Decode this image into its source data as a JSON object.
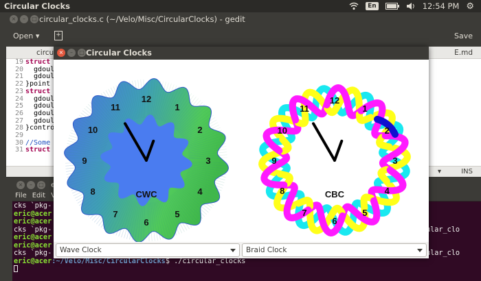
{
  "top_panel": {
    "app_title": "Circular Clocks",
    "keyboard_layout": "En",
    "clock": "12:54 PM",
    "icons": [
      "wifi-icon",
      "keyboard-icon",
      "battery-icon",
      "volume-icon",
      "power-gear-icon"
    ]
  },
  "gedit": {
    "title": "circular_clocks.c (~/Velo/Misc/CircularClocks) - gedit",
    "open_label": "Open",
    "save_label": "Save",
    "tab_left": "circul",
    "tab_right": "E.md",
    "status_ins": "INS",
    "code_lines": [
      {
        "n": "19",
        "text": "struct",
        "cls": "kw"
      },
      {
        "n": "20",
        "text": "  gdoul",
        "cls": ""
      },
      {
        "n": "21",
        "text": "  gdoul",
        "cls": ""
      },
      {
        "n": "22",
        "text": "}point",
        "cls": ""
      },
      {
        "n": "23",
        "text": "struct",
        "cls": "kw"
      },
      {
        "n": "24",
        "text": "  gdoul",
        "cls": ""
      },
      {
        "n": "25",
        "text": "  gdoul",
        "cls": ""
      },
      {
        "n": "26",
        "text": "  gdoul",
        "cls": ""
      },
      {
        "n": "27",
        "text": "  gdoul",
        "cls": ""
      },
      {
        "n": "28",
        "text": "}contro",
        "cls": ""
      },
      {
        "n": "29",
        "text": "",
        "cls": ""
      },
      {
        "n": "30",
        "text": "//Some",
        "cls": "cm"
      },
      {
        "n": "31",
        "text": "struct",
        "cls": "kw"
      }
    ]
  },
  "terminal": {
    "title": "e",
    "menu": [
      "File",
      "Edit",
      "V"
    ],
    "lines": [
      {
        "pre": "",
        "user": "",
        "path": "",
        "text": "cks `pkg-",
        "right": ""
      },
      {
        "pre": "",
        "user": "eric@acer",
        "path": "",
        "text": "",
        "right": ""
      },
      {
        "pre": "",
        "user": "eric@acer",
        "path": "",
        "text": "",
        "right": ""
      },
      {
        "pre": "",
        "user": "",
        "path": "",
        "text": "cks `pkg-",
        "right": "ular_clo"
      },
      {
        "pre": "",
        "user": "eric@acer",
        "path": "",
        "text": "",
        "right": ""
      },
      {
        "pre": "",
        "user": "eric@acer",
        "path": "",
        "text": "",
        "right": ""
      },
      {
        "pre": "",
        "user": "",
        "path": "",
        "text": "cks `pkg-",
        "right": "ular_clo"
      },
      {
        "pre": "",
        "user": "eric@acer",
        "path": ":~/Velo/Misc/CircularClocks",
        "text": "$ ./circular_clocks",
        "right": ""
      }
    ]
  },
  "clocks_window": {
    "title": "Circular Clocks",
    "left_clock": {
      "label": "CWC",
      "numbers": [
        "12",
        "1",
        "2",
        "3",
        "4",
        "5",
        "6",
        "7",
        "8",
        "9",
        "10",
        "11"
      ],
      "hour_hand_deg": 330,
      "minute_hand_deg": 20
    },
    "right_clock": {
      "label": "CBC",
      "numbers": [
        "12",
        "1",
        "2",
        "3",
        "4",
        "5",
        "6",
        "7",
        "8",
        "9",
        "10",
        "11"
      ],
      "hour_hand_deg": 330,
      "minute_hand_deg": 20
    },
    "left_combo": "Wave Clock",
    "right_combo": "Braid Clock",
    "colors": {
      "wave_blue": "#4a7cf0",
      "wave_green": "#58c24a",
      "braid_magenta": "#ff1aff",
      "braid_cyan": "#19e8f0",
      "braid_yellow": "#ffff19",
      "braid_blue": "#1010d0"
    }
  }
}
